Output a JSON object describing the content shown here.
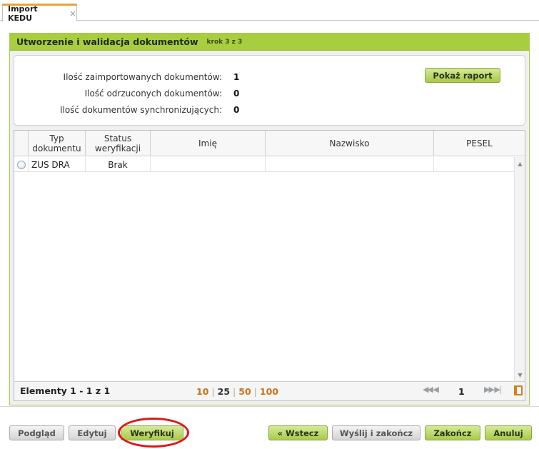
{
  "tab": {
    "label": "Import KEDU",
    "close": "×"
  },
  "panel": {
    "title": "Utworzenie i walidacja dokumentów",
    "step": "krok 3 z 3"
  },
  "summary": {
    "rows": [
      {
        "label": "Ilość zaimportowanych dokumentów:",
        "value": "1"
      },
      {
        "label": "Ilość odrzuconych dokumentów:",
        "value": "0"
      },
      {
        "label": "Ilość dokumentów synchronizujących:",
        "value": "0"
      }
    ],
    "report_button": "Pokaż raport"
  },
  "grid": {
    "columns": [
      "Typ dokumentu",
      "Status weryfikacji",
      "Imię",
      "Nazwisko",
      "PESEL"
    ],
    "rows": [
      {
        "typ": "ZUS DRA",
        "status": "Brak",
        "imie": "",
        "nazwisko": "",
        "pesel": ""
      }
    ]
  },
  "pager": {
    "elements": "Elementy 1 - 1 z 1",
    "sizes": [
      "10",
      "25",
      "50",
      "100"
    ],
    "active_size": "25",
    "page": "1",
    "first_prev": "◀◀ ◀",
    "next_last": "▶▶ ▶|"
  },
  "buttons": {
    "preview": "Podgląd",
    "edit": "Edytuj",
    "verify": "Weryfikuj",
    "back": "« Wstecz",
    "send_finish": "Wyślij i zakończ",
    "finish": "Zakończ",
    "cancel": "Anuluj"
  },
  "colors": {
    "accent": "#a8cd3e",
    "tab_top": "#e8a33a",
    "highlight_ring": "#e0161b",
    "pager_link": "#c9731b"
  }
}
